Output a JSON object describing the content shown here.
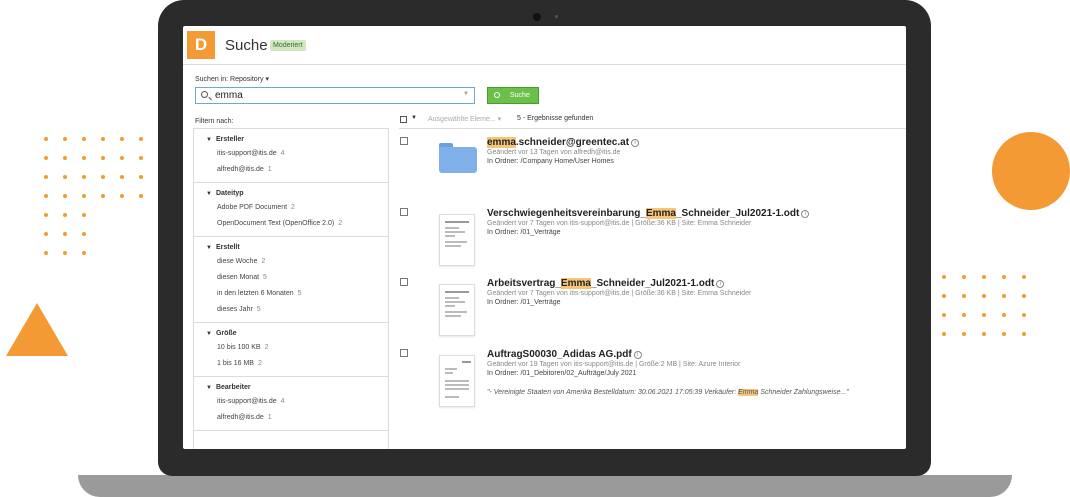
{
  "colors": {
    "accent": "#f39a34",
    "green_button": "#6cc04a",
    "highlight": "#f7c57a",
    "folder_blue": "#7fb0ea"
  },
  "app": {
    "logo_letter": "D",
    "title": "Suche",
    "badge": "Moderiert"
  },
  "search": {
    "scope_label": "Suchen in:",
    "scope_value": "Repository",
    "query": "emma",
    "button_label": "Suche"
  },
  "filters": {
    "heading": "Filtern nach:",
    "groups": [
      {
        "title": "Ersteller",
        "items": [
          {
            "label": "itis-support@itis.de",
            "count": "4"
          },
          {
            "label": "alfredh@itis.de",
            "count": "1"
          }
        ]
      },
      {
        "title": "Dateityp",
        "items": [
          {
            "label": "Adobe PDF Document",
            "count": "2"
          },
          {
            "label": "OpenDocument Text (OpenOffice 2.0)",
            "count": "2"
          }
        ]
      },
      {
        "title": "Erstellt",
        "items": [
          {
            "label": "diese Woche",
            "count": "2"
          },
          {
            "label": "diesen Monat",
            "count": "5"
          },
          {
            "label": "in den letzten 6 Monaten",
            "count": "5"
          },
          {
            "label": "dieses Jahr",
            "count": "5"
          }
        ]
      },
      {
        "title": "Größe",
        "items": [
          {
            "label": "10 bis 100 KB",
            "count": "2"
          },
          {
            "label": "1 bis 16 MB",
            "count": "2"
          }
        ]
      },
      {
        "title": "Bearbeiter",
        "items": [
          {
            "label": "itis-support@itis.de",
            "count": "4"
          },
          {
            "label": "alfredh@itis.de",
            "count": "1"
          }
        ]
      }
    ]
  },
  "results_toolbar": {
    "selected_label": "Ausgewählte Eleme...",
    "result_count": "5 - Ergebnisse gefunden"
  },
  "results": [
    {
      "type": "folder",
      "title_hl": "emma",
      "title_post": ".schneider@greentec.at",
      "meta": "Geändert vor 13 Tagen von alfredh@itis.de",
      "folder": "In Ordner: /Company Home/User Homes"
    },
    {
      "type": "document",
      "title_pre": "Verschwiegenheitsvereinbarung_",
      "title_hl": "Emma",
      "title_post": "_Schneider_Jul2021-1.odt",
      "meta": "Geändert vor 7 Tagen von itis-support@itis.de | Größe:36 KB | Site: Emma Schneider",
      "folder": "In Ordner: /01_Verträge"
    },
    {
      "type": "document",
      "title_pre": "Arbeitsvertrag_",
      "title_hl": "Emma",
      "title_post": "_Schneider_Jul2021-1.odt",
      "meta": "Geändert vor 7 Tagen von itis-support@itis.de | Größe:36 KB | Site: Emma Schneider",
      "folder": "In Ordner: /01_Verträge"
    },
    {
      "type": "document",
      "title_post": "AuftragS00030_Adidas AG.pdf",
      "meta": "Geändert vor 19 Tagen von itis-support@itis.de | Größe:2 MB | Site: Azure Interior",
      "folder": "In Ordner: /01_Debitoren/02_Aufträge/July 2021",
      "snippet_pre": "\"- Vereinigte Staaten von Amerika Bestelldatum: 30.06.2021 17:05:39 Verkäufer: ",
      "snippet_hl": "Emma",
      "snippet_post": " Schneider Zahlungsweise...\""
    }
  ]
}
